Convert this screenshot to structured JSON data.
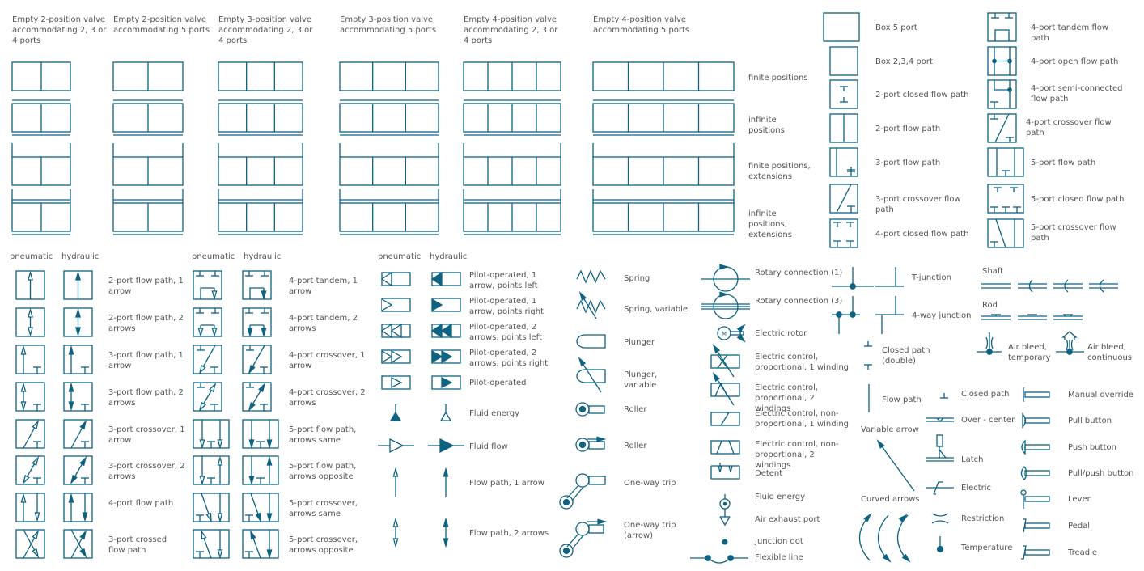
{
  "colors": {
    "stroke": "#0e6282",
    "text": "#555555",
    "background": "#ffffff"
  },
  "valve_grid": {
    "columns": [
      {
        "title": "Empty 2-position valve accommodating 2, 3 or 4 ports",
        "cells": 2
      },
      {
        "title": "Empty 2-position valve accommodating 5 ports",
        "cells": 2
      },
      {
        "title": "Empty 3-position valve accommodating 2, 3 or 4 ports",
        "cells": 3
      },
      {
        "title": "Empty 3-position valve accommodating 5 ports",
        "cells": 3
      },
      {
        "title": "Empty 4-position valve accommodating 2, 3 or 4 ports",
        "cells": 4
      },
      {
        "title": "Empty 4-position valve accommodating 5 ports",
        "cells": 4
      }
    ],
    "rows": [
      {
        "label": "finite positions",
        "kind": "finite"
      },
      {
        "label": "infinite positions",
        "kind": "infinite"
      },
      {
        "label": "finite positions, extensions",
        "kind": "finite-ext"
      },
      {
        "label": "infinite positions, extensions",
        "kind": "infinite-ext"
      }
    ]
  },
  "boxes_left": [
    {
      "label": "Box 5 port",
      "symbol": "box5"
    },
    {
      "label": "Box 2,3,4 port",
      "symbol": "box"
    },
    {
      "label": "2-port closed flow path",
      "symbol": "2p-closed"
    },
    {
      "label": "2-port flow path",
      "symbol": "2p-flow"
    },
    {
      "label": "3-port flow path",
      "symbol": "3p-flow"
    },
    {
      "label": "3-port crossover flow path",
      "symbol": "3p-cross"
    },
    {
      "label": "4-port closed flow path",
      "symbol": "4p-closed"
    }
  ],
  "boxes_right": [
    {
      "label": "4-port tandem flow path",
      "symbol": "4p-tandem"
    },
    {
      "label": "4-port open flow path",
      "symbol": "4p-open"
    },
    {
      "label": "4-port semi-connected flow path",
      "symbol": "4p-semi"
    },
    {
      "label": "4-port crossover flow path",
      "symbol": "4p-cross"
    },
    {
      "label": "5-port flow path",
      "symbol": "5p-flow"
    },
    {
      "label": "5-port closed flow path",
      "symbol": "5p-closed"
    },
    {
      "label": "5-port crossover flow path",
      "symbol": "5p-cross"
    }
  ],
  "column_headers": {
    "pneumatic": "pneumatic",
    "hydraulic": "hydraulic"
  },
  "arrow_paths_a": [
    {
      "label": "2-port flow path, 1 arrow",
      "symbol": "a2p1"
    },
    {
      "label": "2-port flow path, 2 arrows",
      "symbol": "a2p2"
    },
    {
      "label": "3-port flow path, 1 arrow",
      "symbol": "a3p1"
    },
    {
      "label": "3-port flow path, 2 arrows",
      "symbol": "a3p2"
    },
    {
      "label": "3-port crossover, 1 arrow",
      "symbol": "a3c1"
    },
    {
      "label": "3-port crossover, 2 arrows",
      "symbol": "a3c2"
    },
    {
      "label": "4-port flow path",
      "symbol": "a4p"
    },
    {
      "label": "3-port crossed flow path",
      "symbol": "a3x"
    }
  ],
  "arrow_paths_b": [
    {
      "label": "4-port tandem, 1 arrow",
      "symbol": "b4t1"
    },
    {
      "label": "4-port tandem, 2 arrows",
      "symbol": "b4t2"
    },
    {
      "label": "4-port crossover, 1 arrow",
      "symbol": "b4c1"
    },
    {
      "label": "4-port crossover, 2 arrows",
      "symbol": "b4c2"
    },
    {
      "label": "5-port flow path, arrows same",
      "symbol": "b5s"
    },
    {
      "label": "5-port flow path, arrows opposite",
      "symbol": "b5o"
    },
    {
      "label": "5-port crossover, arrows same",
      "symbol": "b5cs"
    },
    {
      "label": "5-port crossover, arrows opposite",
      "symbol": "b5co"
    }
  ],
  "pilot": [
    {
      "label": "Pilot-operated, 1 arrow, points left",
      "symbol": "pl1"
    },
    {
      "label": "Pilot-operated, 1 arrow, points right",
      "symbol": "pr1"
    },
    {
      "label": "Pilot-operated, 2 arrows, points left",
      "symbol": "pl2"
    },
    {
      "label": "Pilot-operated, 2 arrows, points right",
      "symbol": "pr2"
    },
    {
      "label": "Pilot-operated",
      "symbol": "pc"
    },
    {
      "label": "Fluid energy",
      "symbol": "fe"
    },
    {
      "label": "Fluid flow",
      "symbol": "ff"
    },
    {
      "label": "Flow path, 1 arrow",
      "symbol": "fp1"
    },
    {
      "label": "Flow path, 2 arrows",
      "symbol": "fp2"
    }
  ],
  "mechanical": [
    {
      "label": "Spring",
      "symbol": "spring"
    },
    {
      "label": "Spring, variable",
      "symbol": "spring-var"
    },
    {
      "label": "Plunger",
      "symbol": "plunger"
    },
    {
      "label": "Plunger, variable",
      "symbol": "plunger-var"
    },
    {
      "label": "Roller",
      "symbol": "roller"
    },
    {
      "label": "Roller",
      "symbol": "roller-arrow"
    },
    {
      "label": "One-way trip",
      "symbol": "trip"
    },
    {
      "label": "One-way trip (arrow)",
      "symbol": "trip-arrow"
    }
  ],
  "electrical": [
    {
      "label": "Rotary connection (1)",
      "symbol": "rot1"
    },
    {
      "label": "Rotary connection (3)",
      "symbol": "rot3"
    },
    {
      "label": "Electric rotor",
      "symbol": "rotor"
    },
    {
      "label": "Electric control, proportional, 1 winding",
      "symbol": "ecp1"
    },
    {
      "label": "Electric control, proportional, 2 windings",
      "symbol": "ecp2"
    },
    {
      "label": "Electric control, non-proportional, 1 winding",
      "symbol": "ecn1"
    },
    {
      "label": "Electric control, non-proportional, 2 windings",
      "symbol": "ecn2"
    },
    {
      "label": "Detent",
      "symbol": "detent"
    },
    {
      "label": "Fluid energy",
      "symbol": "fluid-energy"
    },
    {
      "label": "Air exhaust port",
      "symbol": "exhaust"
    },
    {
      "label": "Junction dot",
      "symbol": "jdot"
    },
    {
      "label": "Flexible line",
      "symbol": "flex"
    }
  ],
  "junctions": {
    "t_junction": "T-junction",
    "four_way": "4-way junction",
    "closed_double": "Closed path (double)",
    "flow_path": "Flow path",
    "variable_arrow": "Variable arrow",
    "curved_arrows": "Curved arrows"
  },
  "misc": [
    {
      "label": "Closed path",
      "symbol": "closed"
    },
    {
      "label": "Over - center",
      "symbol": "overcenter"
    },
    {
      "label": "Latch",
      "symbol": "latch"
    },
    {
      "label": "Electric",
      "symbol": "electric"
    },
    {
      "label": "Restriction",
      "symbol": "restriction"
    },
    {
      "label": "Temperature",
      "symbol": "temperature"
    }
  ],
  "shaft_rod": {
    "shaft": "Shaft",
    "rod": "Rod",
    "air_bleed_temp": "Air bleed, temporary",
    "air_bleed_cont": "Air bleed, continuous"
  },
  "manual": [
    {
      "label": "Manual override",
      "symbol": "manual"
    },
    {
      "label": "Pull button",
      "symbol": "pull"
    },
    {
      "label": "Push button",
      "symbol": "push"
    },
    {
      "label": "Pull/push button",
      "symbol": "pullpush"
    },
    {
      "label": "Lever",
      "symbol": "lever"
    },
    {
      "label": "Pedal",
      "symbol": "pedal"
    },
    {
      "label": "Treadle",
      "symbol": "treadle"
    }
  ]
}
